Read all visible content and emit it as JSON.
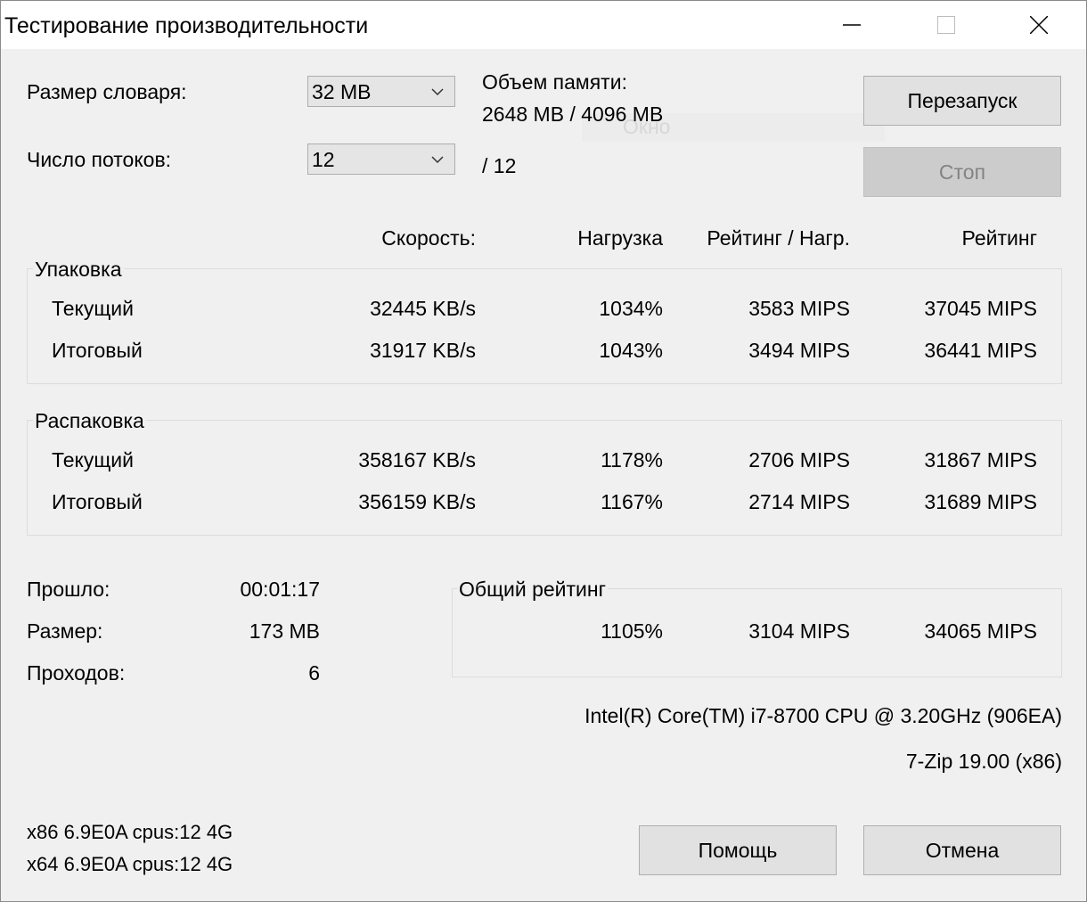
{
  "window": {
    "title": "Тестирование производительности",
    "ghost_text": "Окно"
  },
  "settings": {
    "dict_label": "Размер словаря:",
    "dict_value": "32 MB",
    "threads_label": "Число потоков:",
    "threads_value": "12",
    "threads_total": "/ 12",
    "memory_label": "Объем памяти:",
    "memory_value": "2648 MB / 4096 MB"
  },
  "buttons": {
    "restart": "Перезапуск",
    "stop": "Стоп",
    "help": "Помощь",
    "cancel": "Отмена"
  },
  "columns": {
    "speed": "Скорость:",
    "usage": "Нагрузка",
    "rating_per_usage": "Рейтинг / Нагр.",
    "rating": "Рейтинг"
  },
  "compress": {
    "title": "Упаковка",
    "rows": [
      {
        "label": "Текущий",
        "speed": "32445 KB/s",
        "usage": "1034%",
        "rpu": "3583 MIPS",
        "rating": "37045 MIPS"
      },
      {
        "label": "Итоговый",
        "speed": "31917 KB/s",
        "usage": "1043%",
        "rpu": "3494 MIPS",
        "rating": "36441 MIPS"
      }
    ]
  },
  "decompress": {
    "title": "Распаковка",
    "rows": [
      {
        "label": "Текущий",
        "speed": "358167 KB/s",
        "usage": "1178%",
        "rpu": "2706 MIPS",
        "rating": "31867 MIPS"
      },
      {
        "label": "Итоговый",
        "speed": "356159 KB/s",
        "usage": "1167%",
        "rpu": "2714 MIPS",
        "rating": "31689 MIPS"
      }
    ]
  },
  "stats": {
    "elapsed_label": "Прошло:",
    "elapsed_value": "00:01:17",
    "size_label": "Размер:",
    "size_value": "173 MB",
    "passes_label": "Проходов:",
    "passes_value": "6"
  },
  "total": {
    "title": "Общий рейтинг",
    "usage": "1105%",
    "rpu": "3104 MIPS",
    "rating": "34065 MIPS"
  },
  "system": {
    "cpu": "Intel(R) Core(TM) i7-8700 CPU @ 3.20GHz (906EA)",
    "version": "7-Zip 19.00 (x86)",
    "info_line1": "x86 6.9E0A cpus:12 4G",
    "info_line2": "x64 6.9E0A cpus:12 4G"
  }
}
